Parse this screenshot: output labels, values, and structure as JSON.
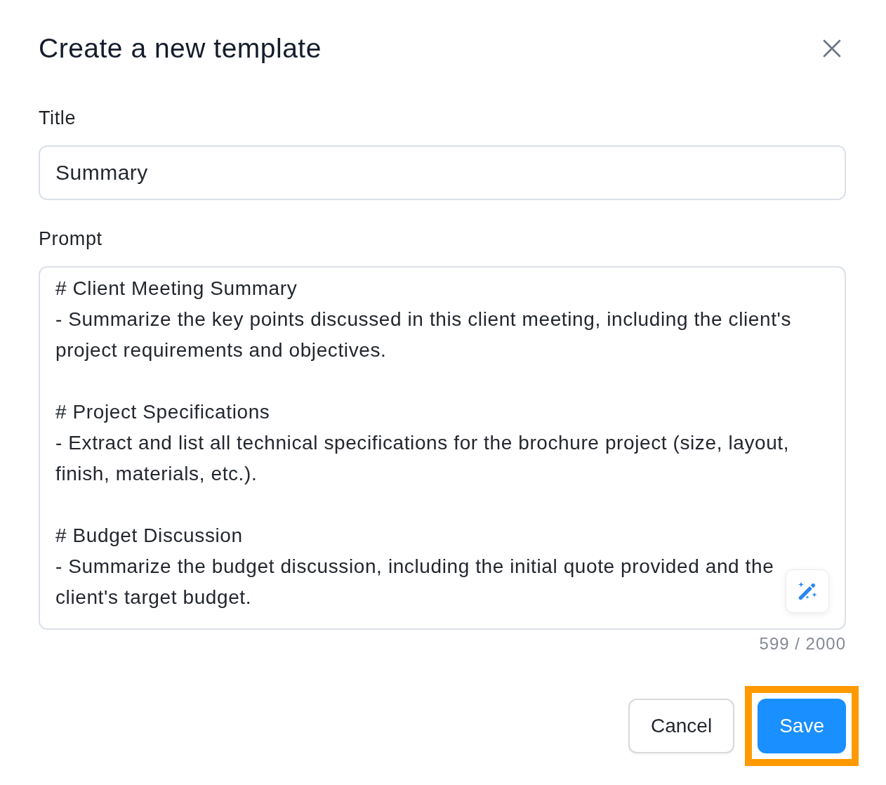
{
  "dialog": {
    "title": "Create a new template"
  },
  "fields": [
    {
      "kind": "input",
      "label": "Title",
      "value": "Summary"
    },
    {
      "kind": "textarea",
      "label": "Prompt",
      "value": "# Client Meeting Summary\n- Summarize the key points discussed in this client meeting, including the client's project requirements and objectives.\n\n# Project Specifications\n- Extract and list all technical specifications for the brochure project (size, layout, finish, materials, etc.).\n\n# Budget Discussion\n- Summarize the budget discussion, including the initial quote provided and the client's target budget.",
      "counter": "599 / 2000"
    }
  ],
  "buttons": [
    {
      "kind": "secondary",
      "label": "Cancel",
      "highlighted": false
    },
    {
      "kind": "primary",
      "label": "Save",
      "highlighted": true
    }
  ]
}
